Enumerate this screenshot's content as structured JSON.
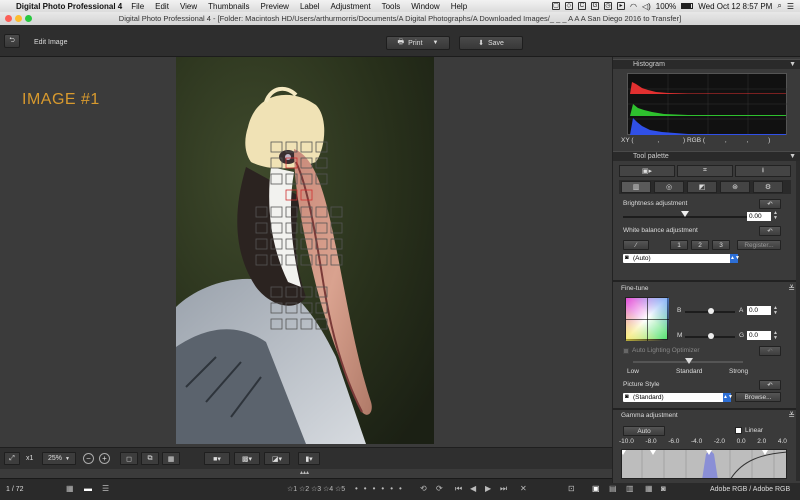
{
  "menubar": {
    "app_name": "Digital Photo Professional 4",
    "items": [
      "File",
      "Edit",
      "View",
      "Thumbnails",
      "Preview",
      "Label",
      "Adjustment",
      "Tools",
      "Window",
      "Help"
    ],
    "battery": "100%",
    "clock": "Wed Oct 12  8:57 PM"
  },
  "window": {
    "title": "Digital Photo Professional 4 - [Folder: Macintosh HD/Users/arthurmorris/Documents/A Digital Photographs/A Downloaded Images/_ _ _ A A A San Diego 2016 to Transfer]"
  },
  "toolbar": {
    "mode_label": "Edit Image",
    "print_label": "Print",
    "save_label": "Save"
  },
  "viewer": {
    "overlay_label": "IMAGE #1"
  },
  "viewbar": {
    "zoom_1x": "x1",
    "zoom_percent": "25%"
  },
  "status": {
    "page_counter": "1 / 72",
    "ratings": [
      "1",
      "2",
      "3",
      "4",
      "5"
    ],
    "color_space": "Adobe RGB / Adobe RGB"
  },
  "histogram": {
    "title": "Histogram",
    "xy_label": "XY (",
    "xy_sep": ",",
    "rgb_label": ") RGB (",
    "rgb_sep": ",",
    "rgb_close": ")"
  },
  "tool_palette": {
    "title": "Tool palette",
    "brightness": {
      "label": "Brightness adjustment",
      "value": "0.00",
      "level": 0.5
    },
    "white_balance": {
      "label": "White balance adjustment",
      "presets": [
        "1",
        "2",
        "3"
      ],
      "register_label": "Register...",
      "selected": "(Auto)"
    }
  },
  "fine_tune": {
    "title": "Fine-tune",
    "b_label": "B",
    "a_label": "A",
    "m_label": "M",
    "g_label": "G",
    "a_value": "0.0",
    "g_value": "0.0",
    "alo_label": "Auto Lighting Optimizer",
    "alo_levels": [
      "Low",
      "Standard",
      "Strong"
    ],
    "picture_style_label": "Picture Style",
    "picture_style_selected": "(Standard)",
    "browse_label": "Browse..."
  },
  "gamma": {
    "title": "Gamma adjustment",
    "auto_label": "Auto",
    "linear_label": "Linear",
    "scale": [
      "-10.0",
      "-8.0",
      "-6.0",
      "-4.0",
      "-2.0",
      "0.0",
      "2.0",
      "4.0"
    ]
  },
  "colors": {
    "accent_orange": "#d89a2e",
    "dropdown_blue": "#2d6fd6",
    "af_point_color": "#d03030"
  }
}
